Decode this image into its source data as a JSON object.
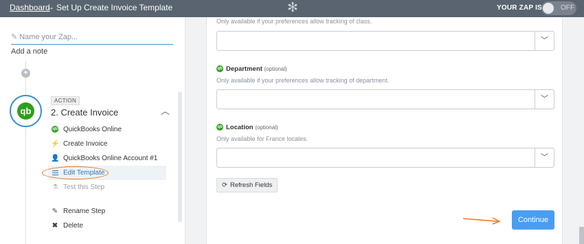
{
  "topbar": {
    "breadcrumb_link": "Dashboard",
    "breadcrumb_arrow": "→",
    "page_title": "Set Up Create Invoice Template",
    "zap_status_label": "YOUR ZAP IS",
    "toggle_label": "OFF",
    "gear_glyph": "✻"
  },
  "sidebar": {
    "name_placeholder": "Name your Zap...",
    "add_note": "Add a note",
    "plus_glyph": "+",
    "step": {
      "badge": "ACTION",
      "title": "2. Create Invoice",
      "app_glyph": "qb",
      "items": [
        {
          "label": "QuickBooks Online",
          "icon": "quickbooks-icon"
        },
        {
          "label": "Create Invoice",
          "icon": "lightning-icon"
        },
        {
          "label": "QuickBooks Online Account #1",
          "icon": "user-icon"
        },
        {
          "label": "Edit Template",
          "icon": "list-icon"
        },
        {
          "label": "Test this Step",
          "icon": "flask-icon"
        }
      ],
      "rename_label": "Rename Step",
      "delete_label": "Delete"
    }
  },
  "form": {
    "class_help": "Only available if your preferences allow tracking of class.",
    "department": {
      "label": "Department",
      "optional": "(optional)",
      "help": "Only available if your preferences allow tracking of department."
    },
    "location": {
      "label": "Location",
      "optional": "(optional)",
      "help": "Only available for France locales."
    },
    "refresh_label": "Refresh Fields",
    "continue_label": "Continue"
  },
  "colors": {
    "topbar": "#596470",
    "accent_blue": "#499df3",
    "quickbooks_green": "#2ca01c",
    "annotation_orange": "#e07b24"
  }
}
